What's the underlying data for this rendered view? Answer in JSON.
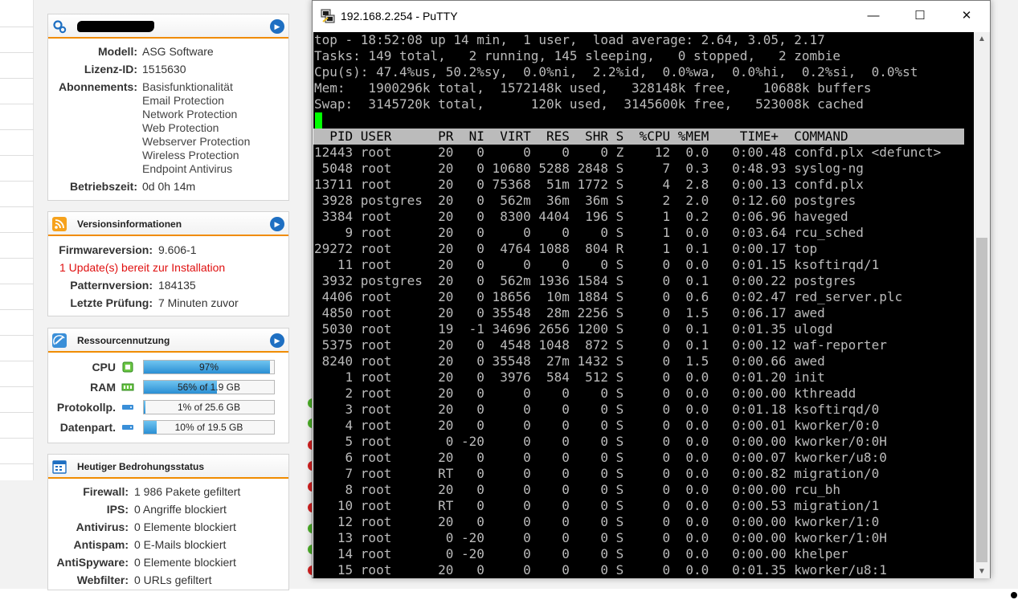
{
  "window": {
    "title": "192.168.2.254 - PuTTY"
  },
  "system": {
    "model_label": "Modell:",
    "model_value": "ASG Software",
    "license_label": "Lizenz-ID:",
    "license_value": "1515630",
    "subscriptions_label": "Abonnements:",
    "subscriptions": [
      "Basisfunktionalität",
      "Email Protection",
      "Network Protection",
      "Web Protection",
      "Webserver Protection",
      "Wireless Protection",
      "Endpoint Antivirus"
    ],
    "uptime_label": "Betriebszeit:",
    "uptime_value": "0d 0h 14m"
  },
  "version": {
    "title": "Versionsinformationen",
    "firmware_label": "Firmwareversion:",
    "firmware_value": "9.606-1",
    "update_notice": "1 Update(s) bereit zur Installation",
    "pattern_label": "Patternversion:",
    "pattern_value": "184135",
    "last_check_label": "Letzte Prüfung:",
    "last_check_value": "7 Minuten zuvor"
  },
  "resources": {
    "title": "Ressourcennutzung",
    "cpu": {
      "label": "CPU",
      "text": "97%",
      "percent": 97
    },
    "ram": {
      "label": "RAM",
      "text": "56% of 1.9 GB",
      "percent": 56
    },
    "log_partition": {
      "label": "Protokollp.",
      "text": "1% of 25.6 GB",
      "percent": 1
    },
    "data_partition": {
      "label": "Datenpart.",
      "text": "10% of 19.5 GB",
      "percent": 10
    }
  },
  "threats": {
    "title": "Heutiger Bedrohungsstatus",
    "rows": [
      {
        "label": "Firewall:",
        "value": "1 986 Pakete gefiltert"
      },
      {
        "label": "IPS:",
        "value": "0 Angriffe blockiert"
      },
      {
        "label": "Antivirus:",
        "value": "0 Elemente blockiert"
      },
      {
        "label": "Antispam:",
        "value": "0 E-Mails blockiert"
      },
      {
        "label": "AntiSpyware:",
        "value": "0 Elemente blockiert"
      },
      {
        "label": "Webfilter:",
        "value": "0 URLs gefiltert"
      }
    ]
  },
  "terminal": {
    "summary": [
      "top - 18:52:08 up 14 min,  1 user,  load average: 2.64, 3.05, 2.17",
      "Tasks: 149 total,   2 running, 145 sleeping,   0 stopped,   2 zombie",
      "Cpu(s): 47.4%us, 50.2%sy,  0.0%ni,  2.2%id,  0.0%wa,  0.0%hi,  0.2%si,  0.0%st",
      "Mem:   1900296k total,  1572148k used,   328148k free,    10688k buffers",
      "Swap:  3145720k total,      120k used,  3145600k free,   523008k cached"
    ],
    "header": "  PID USER      PR  NI  VIRT  RES  SHR S  %CPU %MEM    TIME+  COMMAND",
    "rows": [
      "12443 root      20   0     0    0    0 Z    12  0.0   0:00.48 confd.plx <defunct>",
      " 5048 root      20   0 10680 5288 2848 S     7  0.3   0:48.93 syslog-ng",
      "13711 root      20   0 75368  51m 1772 S     4  2.8   0:00.13 confd.plx",
      " 3928 postgres  20   0  562m  36m  36m S     2  2.0   0:12.60 postgres",
      " 3384 root      20   0  8300 4404  196 S     1  0.2   0:06.96 haveged",
      "    9 root      20   0     0    0    0 S     1  0.0   0:03.64 rcu_sched",
      "29272 root      20   0  4764 1088  804 R     1  0.1   0:00.17 top",
      "   11 root      20   0     0    0    0 S     0  0.0   0:01.15 ksoftirqd/1",
      " 3932 postgres  20   0  562m 1936 1584 S     0  0.1   0:00.22 postgres",
      " 4406 root      20   0 18656  10m 1884 S     0  0.6   0:02.47 red_server.plc",
      " 4850 root      20   0 35548  28m 2256 S     0  1.5   0:06.17 awed",
      " 5030 root      19  -1 34696 2656 1200 S     0  0.1   0:01.35 ulogd",
      " 5375 root      20   0  4548 1048  872 S     0  0.1   0:00.12 waf-reporter",
      " 8240 root      20   0 35548  27m 1432 S     0  1.5   0:00.66 awed",
      "    1 root      20   0  3976  584  512 S     0  0.0   0:01.20 init",
      "    2 root      20   0     0    0    0 S     0  0.0   0:00.00 kthreadd",
      "    3 root      20   0     0    0    0 S     0  0.0   0:01.18 ksoftirqd/0",
      "    4 root      20   0     0    0    0 S     0  0.0   0:00.01 kworker/0:0",
      "    5 root       0 -20     0    0    0 S     0  0.0   0:00.00 kworker/0:0H",
      "    6 root      20   0     0    0    0 S     0  0.0   0:00.07 kworker/u8:0",
      "    7 root      RT   0     0    0    0 S     0  0.0   0:00.82 migration/0",
      "    8 root      20   0     0    0    0 S     0  0.0   0:00.00 rcu_bh",
      "   10 root      RT   0     0    0    0 S     0  0.0   0:00.53 migration/1",
      "   12 root      20   0     0    0    0 S     0  0.0   0:00.00 kworker/1:0",
      "   13 root       0 -20     0    0    0 S     0  0.0   0:00.00 kworker/1:0H",
      "   14 root       0 -20     0    0    0 S     0  0.0   0:00.00 khelper",
      "   15 root      20   0     0    0    0 S     0  0.0   0:01.35 kworker/u8:1"
    ]
  },
  "colors": {
    "accent_orange": "#f08c00",
    "link_blue": "#1e6fc2",
    "update_red": "#e01010",
    "terminal_bg": "#000000",
    "terminal_fg": "#bbbbbb",
    "cursor_green": "#00ff00"
  }
}
